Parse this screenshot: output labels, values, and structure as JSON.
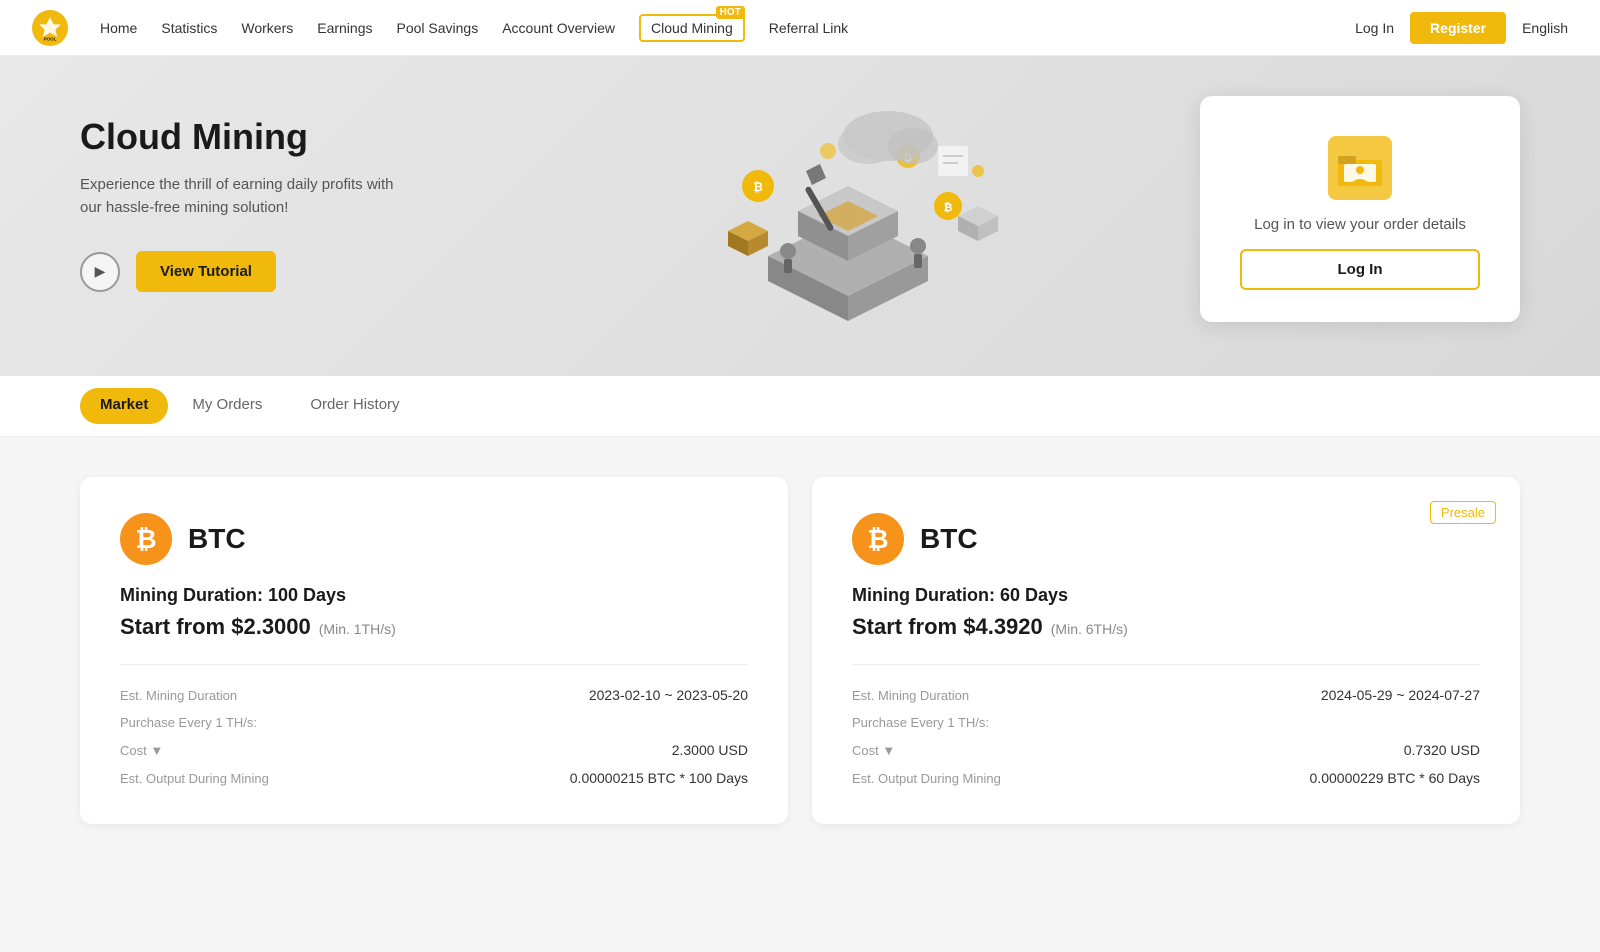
{
  "nav": {
    "logo_text": "BINANCE\nPOOL",
    "links": [
      {
        "label": "Home",
        "id": "home"
      },
      {
        "label": "Statistics",
        "id": "statistics"
      },
      {
        "label": "Workers",
        "id": "workers"
      },
      {
        "label": "Earnings",
        "id": "earnings"
      },
      {
        "label": "Pool Savings",
        "id": "pool-savings"
      },
      {
        "label": "Account Overview",
        "id": "account-overview"
      },
      {
        "label": "Cloud Mining",
        "id": "cloud-mining",
        "hot": true
      },
      {
        "label": "Referral Link",
        "id": "referral-link"
      }
    ],
    "login_label": "Log In",
    "register_label": "Register",
    "language": "English"
  },
  "hero": {
    "title": "Cloud Mining",
    "subtitle": "Experience the thrill of earning daily profits with our hassle-free mining solution!",
    "view_tutorial_label": "View Tutorial",
    "login_card": {
      "text": "Log in to view your order details",
      "login_button": "Log In"
    }
  },
  "tabs": [
    {
      "label": "Market",
      "active": true
    },
    {
      "label": "My Orders",
      "active": false
    },
    {
      "label": "Order History",
      "active": false
    }
  ],
  "cards": [
    {
      "currency": "BTC",
      "duration_label": "Mining Duration: 100 Days",
      "price_label": "Start from $2.3000",
      "price_min": "(Min. 1TH/s)",
      "presale": false,
      "details": [
        {
          "label": "Est. Mining Duration",
          "value": "2023-02-10 ~ 2023-05-20"
        },
        {
          "label": "Purchase Every 1 TH/s:",
          "value": ""
        },
        {
          "label": "Cost ▼",
          "value": "2.3000 USD"
        },
        {
          "label": "Est. Output During Mining",
          "value": "0.00000215 BTC * 100 Days"
        }
      ]
    },
    {
      "currency": "BTC",
      "duration_label": "Mining Duration: 60 Days",
      "price_label": "Start from $4.3920",
      "price_min": "(Min. 6TH/s)",
      "presale": true,
      "presale_label": "Presale",
      "details": [
        {
          "label": "Est. Mining Duration",
          "value": "2024-05-29 ~ 2024-07-27"
        },
        {
          "label": "Purchase Every 1 TH/s:",
          "value": ""
        },
        {
          "label": "Cost ▼",
          "value": "0.7320 USD"
        },
        {
          "label": "Est. Output During Mining",
          "value": "0.00000229 BTC * 60 Days"
        }
      ]
    }
  ],
  "colors": {
    "primary": "#f0b90b",
    "btc_orange": "#f7931a",
    "text_dark": "#1a1a1a",
    "text_gray": "#555",
    "bg_gray": "#f5f5f5"
  }
}
